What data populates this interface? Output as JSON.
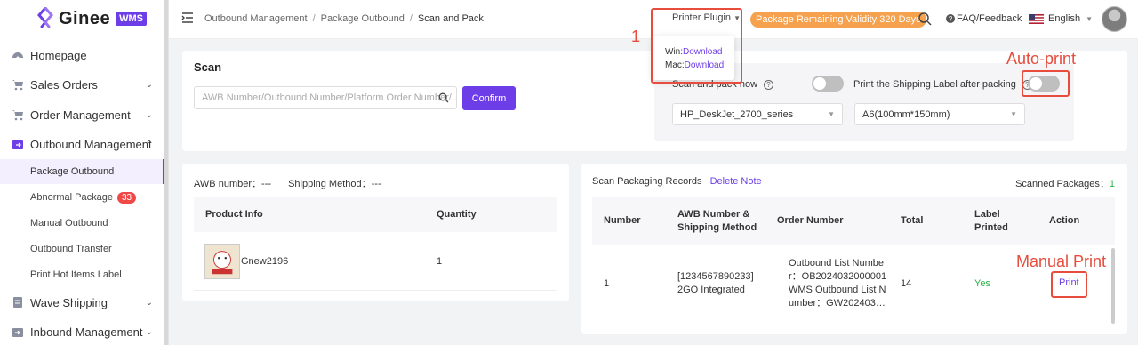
{
  "sidebar": {
    "logo": {
      "text": "Ginee",
      "badge": "WMS"
    },
    "items": [
      {
        "label": "Homepage",
        "icon": "dashboard-icon"
      },
      {
        "label": "Sales Orders",
        "icon": "cart-icon"
      },
      {
        "label": "Order Management",
        "icon": "cart-icon"
      },
      {
        "label": "Outbound Management",
        "icon": "outbound-box-icon"
      }
    ],
    "sub_items": [
      {
        "label": "Package Outbound"
      },
      {
        "label": "Abnormal Package",
        "badge": "33"
      },
      {
        "label": "Manual Outbound"
      },
      {
        "label": "Outbound Transfer"
      },
      {
        "label": "Print Hot Items Label"
      }
    ],
    "items_after": [
      {
        "label": "Wave Shipping",
        "icon": "wave-doc-icon"
      },
      {
        "label": "Inbound Management",
        "icon": "inbound-box-icon"
      }
    ]
  },
  "topbar": {
    "breadcrumb": [
      "Outbound Management",
      "Package Outbound",
      "Scan and Pack"
    ],
    "printer_plugin": "Printer Plugin",
    "validity": "Package Remaining Validity 320 Days",
    "faq": "FAQ/Feedback",
    "language": "English"
  },
  "popup": {
    "win_label": "Win:",
    "win_link": "Download",
    "mac_label": "Mac:",
    "mac_link": "Download"
  },
  "annotations": {
    "num1": "1",
    "auto_print": "Auto-print",
    "manual_print": "Manual Print"
  },
  "scan": {
    "title": "Scan",
    "input_placeholder": "AWB Number/Outbound Number/Platform Order Number/...",
    "confirm": "Confirm",
    "scan_pack_now": "Scan and pack now",
    "print_label_after": "Print the Shipping Label after packing",
    "printer_select": "HP_DeskJet_2700_series",
    "paper_select": "A6(100mm*150mm)"
  },
  "info": {
    "awb": "AWB number：---",
    "shipping_method": "Shipping Method：---",
    "columns": [
      "Product Info",
      "Quantity"
    ],
    "rows": [
      {
        "name": "Gnew2196",
        "qty": "1"
      }
    ]
  },
  "records": {
    "title": "Scan Packaging Records",
    "delete_note": "Delete Note",
    "scanned_label": "Scanned Packages：",
    "scanned_count": "1",
    "columns": {
      "number": "Number",
      "awb_line1": "AWB Number &",
      "awb_line2": "Shipping Method",
      "order": "Order Number",
      "total": "Total",
      "label_line1": "Label",
      "label_line2": "Printed",
      "action": "Action"
    },
    "rows": [
      {
        "number": "1",
        "awb_line1": "[1234567890233]",
        "awb_line2": "2GO Integrated",
        "order_line1": "Outbound List Numbe",
        "order_line2": "r：OB2024032000001",
        "order_line3": "WMS Outbound List N",
        "order_line4": "umber：GW202403…",
        "total": "14",
        "label_printed": "Yes",
        "action": "Print"
      }
    ]
  },
  "colors": {
    "accent": "#6d3ee8",
    "annotation": "#e74c3c",
    "validity": "#f5a14e",
    "yes": "#2db34a"
  }
}
